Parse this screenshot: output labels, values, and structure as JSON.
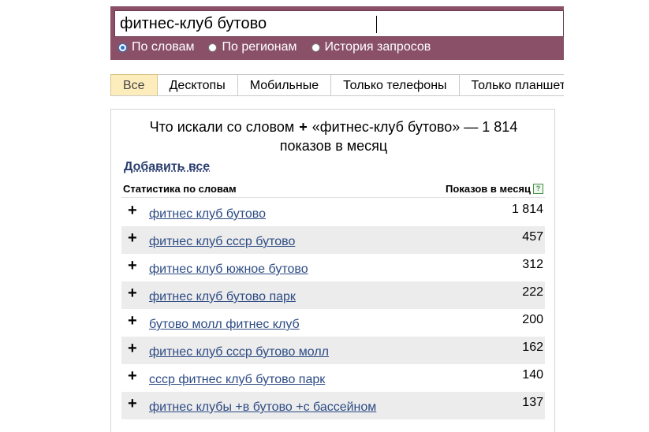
{
  "search": {
    "query": "фитнес-клуб бутово",
    "modes": [
      {
        "label": "По словам",
        "checked": true
      },
      {
        "label": "По регионам",
        "checked": false
      },
      {
        "label": "История запросов",
        "checked": false
      }
    ]
  },
  "tabs": [
    {
      "label": "Все",
      "active": true
    },
    {
      "label": "Десктопы",
      "active": false
    },
    {
      "label": "Мобильные",
      "active": false
    },
    {
      "label": "Только телефоны",
      "active": false
    },
    {
      "label": "Только планшеты",
      "active": false
    }
  ],
  "results": {
    "headline_before": "Что искали со словом",
    "headline_plus": "+",
    "headline_after": "«фитнес-клуб бутово» — 1 814",
    "headline_line2": "показов в месяц",
    "add_all": "Добавить все",
    "col_words": "Статистика по словам",
    "col_shows": "Показов в месяц",
    "help_icon": "?",
    "plus_symbol": "+",
    "rows": [
      {
        "phrase": "фитнес клуб бутово",
        "count": "1 814"
      },
      {
        "phrase": "фитнес клуб ссср бутово",
        "count": "457"
      },
      {
        "phrase": "фитнес клуб южное бутово",
        "count": "312"
      },
      {
        "phrase": "фитнес клуб бутово парк",
        "count": "222"
      },
      {
        "phrase": "бутово молл фитнес клуб",
        "count": "200"
      },
      {
        "phrase": "фитнес клуб ссср бутово молл",
        "count": "162"
      },
      {
        "phrase": "ссср фитнес клуб бутово парк",
        "count": "140"
      },
      {
        "phrase": "фитнес клубы +в бутово +с бассейном",
        "count": "137"
      }
    ]
  },
  "colors": {
    "search_panel": "#8a5068",
    "active_tab": "#fdedbd",
    "link": "#2d4b84",
    "row_shade": "#ececec"
  }
}
